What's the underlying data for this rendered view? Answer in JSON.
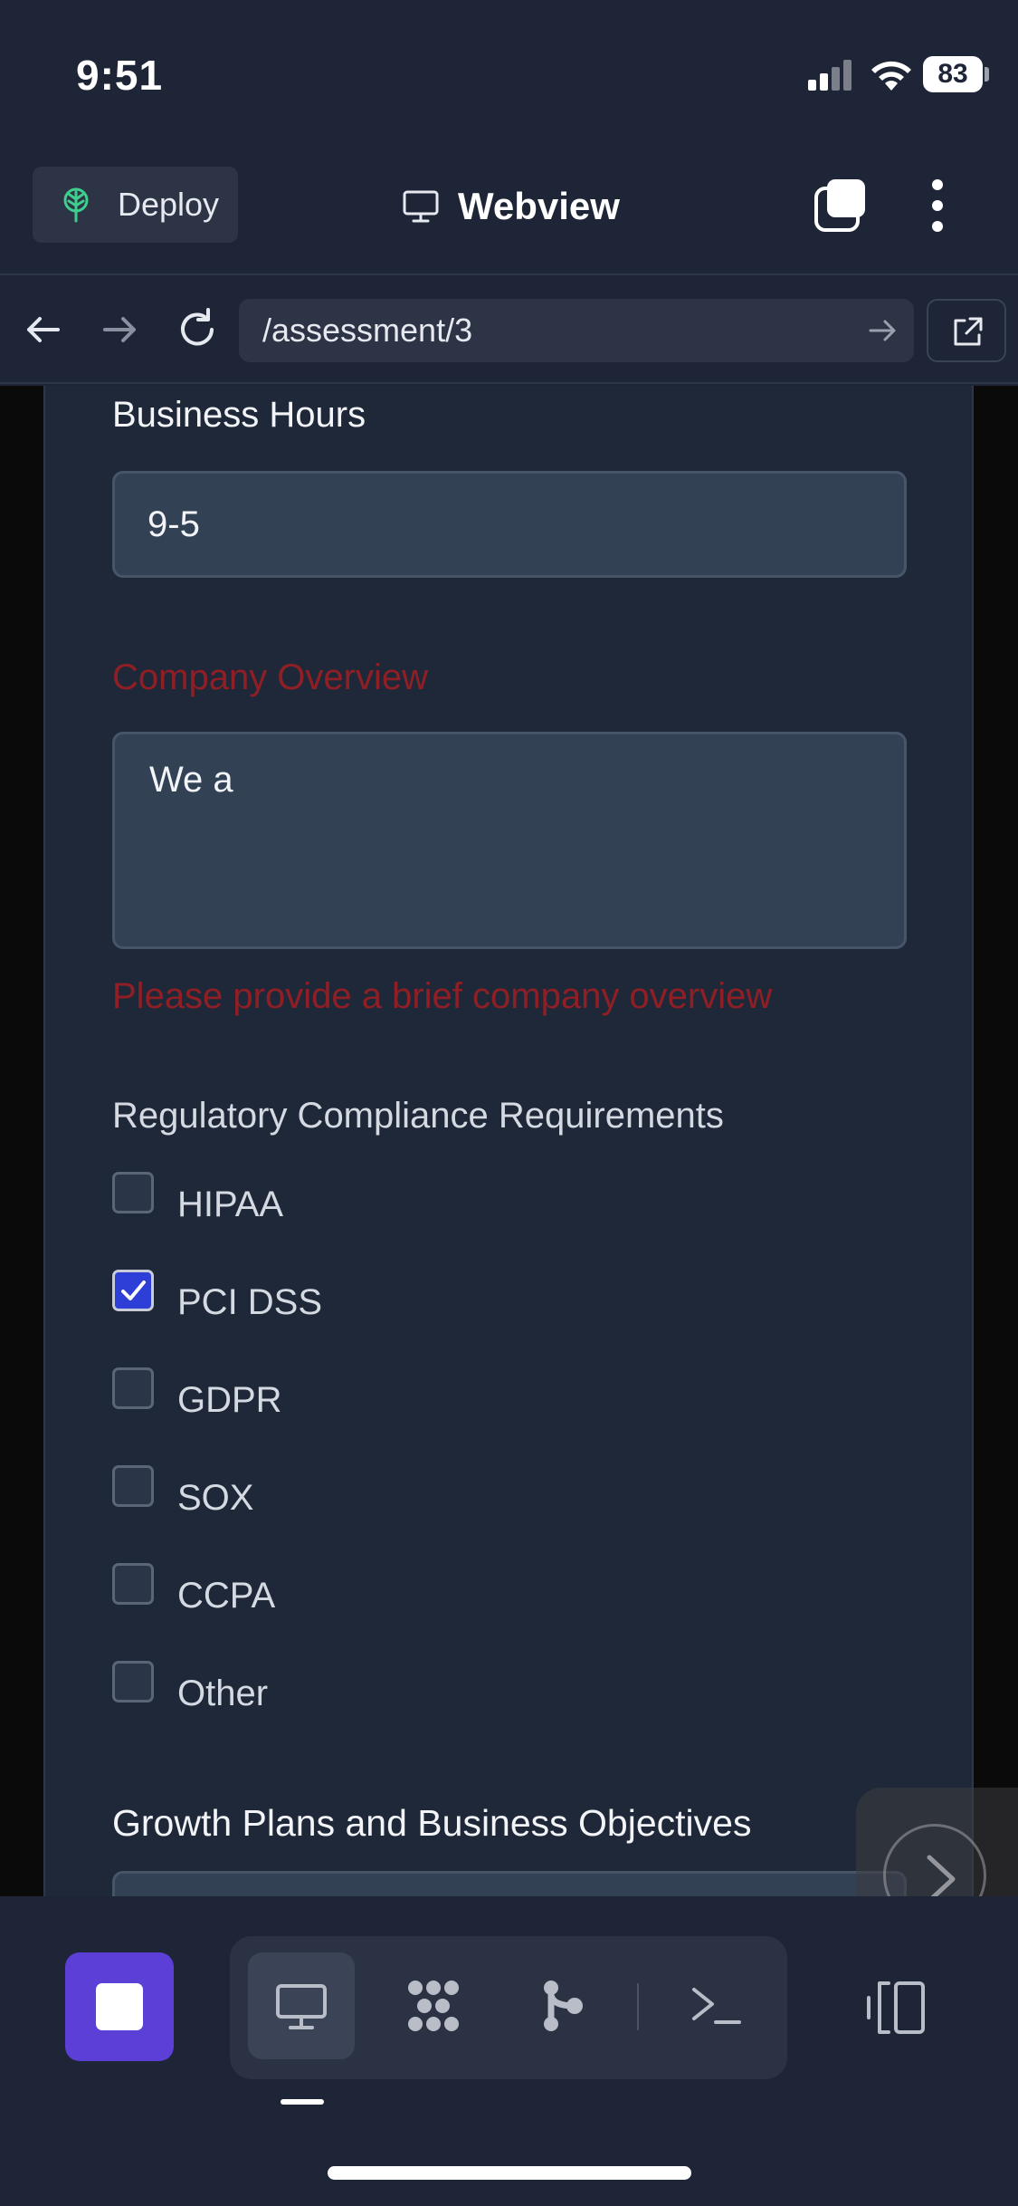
{
  "status_bar": {
    "time": "9:51",
    "battery": "83"
  },
  "header": {
    "deploy_label": "Deploy",
    "title": "Webview"
  },
  "browser": {
    "url": "/assessment/3"
  },
  "form": {
    "business_hours_label": "Business Hours",
    "business_hours_value": "9-5",
    "company_overview_label": "Company Overview",
    "company_overview_value": "We a",
    "company_overview_error": "Please provide a brief company overview",
    "compliance_label": "Regulatory Compliance Requirements",
    "compliance_options": [
      {
        "label": "HIPAA",
        "checked": false
      },
      {
        "label": "PCI DSS",
        "checked": true
      },
      {
        "label": "GDPR",
        "checked": false
      },
      {
        "label": "SOX",
        "checked": false
      },
      {
        "label": "CCPA",
        "checked": false
      },
      {
        "label": "Other",
        "checked": false
      }
    ],
    "growth_label": "Growth Plans and Business Objectives"
  },
  "colors": {
    "background": "#1e2536",
    "error": "#8f1f25",
    "accent": "#5b3fd6",
    "checkbox_checked": "#2e3fd8"
  },
  "icons": {
    "deploy": "deploy-tree-icon",
    "webview": "monitor-icon",
    "tabs": "tabs-icon",
    "menu": "kebab-menu-icon",
    "back": "arrow-left-icon",
    "forward": "arrow-right-icon",
    "reload": "reload-icon",
    "open_external": "external-link-icon",
    "next": "chevron-right-icon",
    "stop": "stop-icon",
    "webview_tool": "monitor-icon",
    "agents_tool": "dots-grid-icon",
    "git_tool": "git-branch-icon",
    "terminal_tool": "terminal-icon",
    "panel_toggle": "side-panel-icon"
  }
}
